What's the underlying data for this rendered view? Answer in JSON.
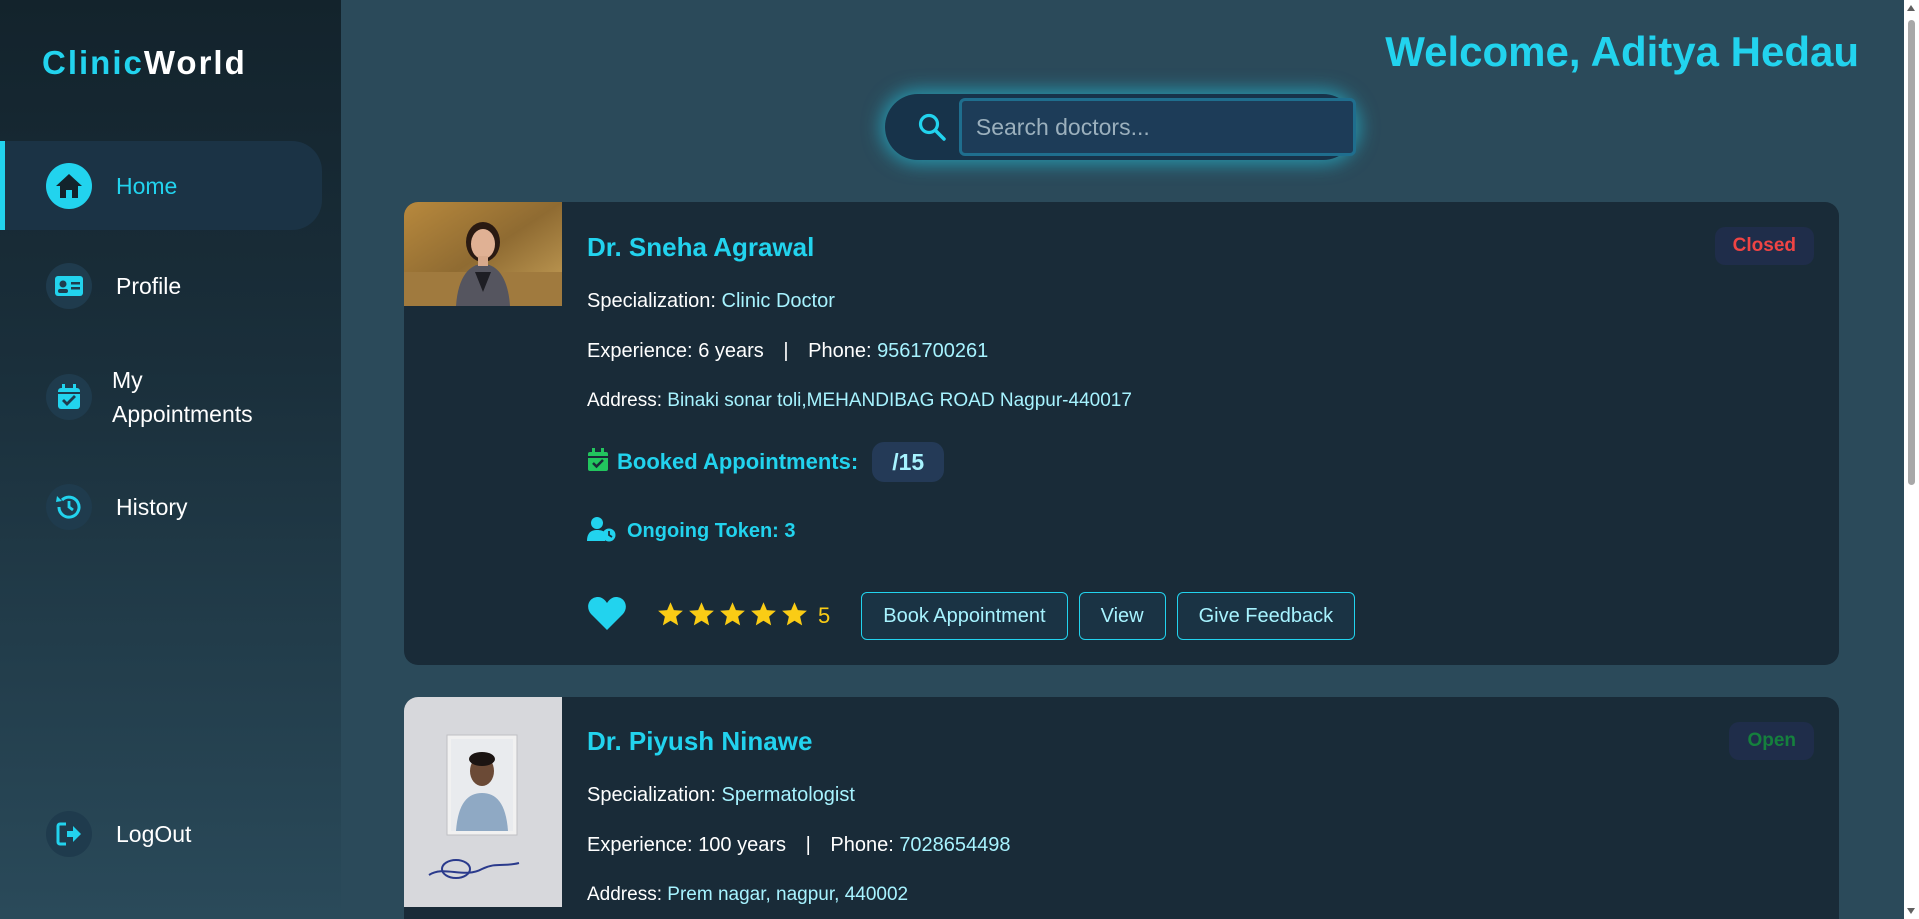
{
  "app": {
    "logo_part1": "Clinic",
    "logo_part2": "World"
  },
  "sidebar": {
    "items": [
      {
        "label": "Home",
        "icon": "home-icon",
        "active": true
      },
      {
        "label": "Profile",
        "icon": "id-card-icon",
        "active": false
      },
      {
        "label": "My\nAppointments",
        "icon": "calendar-check-icon",
        "active": false
      },
      {
        "label": "History",
        "icon": "history-icon",
        "active": false
      }
    ],
    "logout": {
      "label": "LogOut",
      "icon": "logout-icon"
    }
  },
  "header": {
    "welcome": "Welcome, Aditya Hedau"
  },
  "search": {
    "placeholder": "Search doctors...",
    "value": ""
  },
  "labels": {
    "specialization": "Specialization:",
    "experience": "Experience:",
    "phone": "Phone:",
    "address": "Address:",
    "booked": "Booked Appointments:",
    "separator": "|"
  },
  "doctors": [
    {
      "name": "Dr. Sneha Agrawal",
      "status": "Closed",
      "specialization": "Clinic Doctor",
      "experience": "6 years",
      "phone": "9561700261",
      "address": "Binaki sonar toli,MEHANDIBAG ROAD Nagpur-440017",
      "booked": "/15",
      "ongoing_token": "Ongoing Token: 3",
      "rating": "5",
      "stars": 5,
      "buttons": {
        "book": "Book Appointment",
        "view": "View",
        "feedback": "Give Feedback"
      }
    },
    {
      "name": "Dr. Piyush Ninawe",
      "status": "Open",
      "specialization": "Spermatologist",
      "experience": "100 years",
      "phone": "7028654498",
      "address": "Prem nagar, nagpur, 440002"
    }
  ],
  "colors": {
    "accent": "#22d3ee",
    "closed": "#ef4444",
    "open": "#15803d",
    "star": "#facc15",
    "background": "#2b4a5a"
  }
}
